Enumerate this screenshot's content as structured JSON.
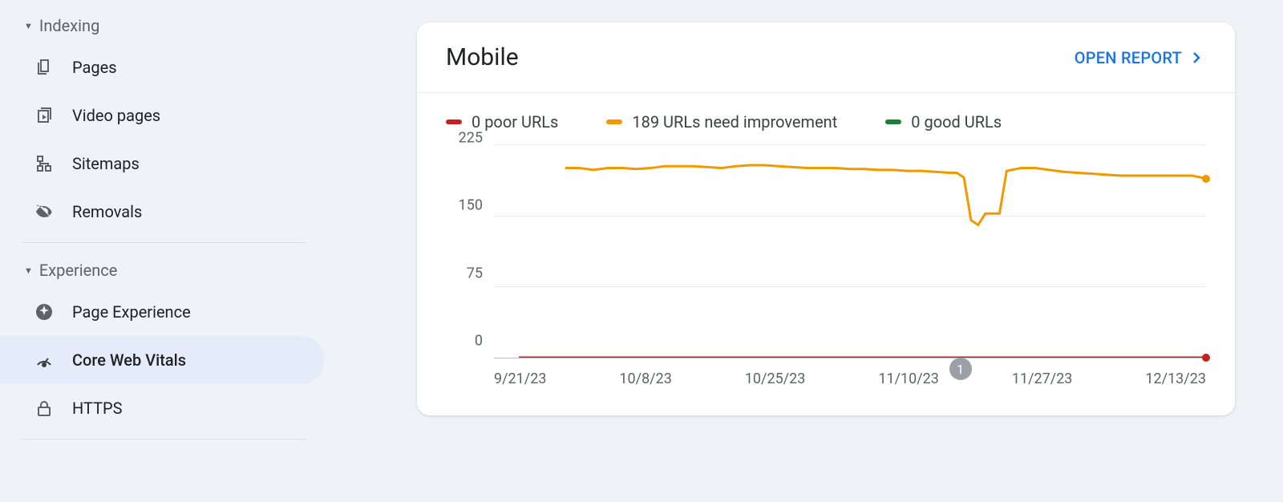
{
  "sidebar": {
    "sections": {
      "indexing": {
        "label": "Indexing",
        "items": [
          {
            "id": "pages",
            "label": "Pages"
          },
          {
            "id": "video-pages",
            "label": "Video pages"
          },
          {
            "id": "sitemaps",
            "label": "Sitemaps"
          },
          {
            "id": "removals",
            "label": "Removals"
          }
        ]
      },
      "experience": {
        "label": "Experience",
        "items": [
          {
            "id": "page-experience",
            "label": "Page Experience"
          },
          {
            "id": "core-web-vitals",
            "label": "Core Web Vitals"
          },
          {
            "id": "https",
            "label": "HTTPS"
          }
        ]
      }
    }
  },
  "card": {
    "title": "Mobile",
    "open_report": "OPEN REPORT"
  },
  "legend": {
    "poor_label": "0 poor URLs",
    "need_label": "189 URLs need improvement",
    "good_label": "0 good URLs"
  },
  "colors": {
    "poor": "#c5221f",
    "need": "#f29900",
    "good": "#188038"
  },
  "marker": {
    "label": "1"
  },
  "chart_data": {
    "type": "line",
    "xlabel": "",
    "ylabel": "",
    "ylim": [
      0,
      225
    ],
    "y_ticks": [
      "225",
      "150",
      "75",
      "0"
    ],
    "x_ticks": [
      "9/21/23",
      "10/8/23",
      "10/25/23",
      "11/10/23",
      "11/27/23",
      "12/13/23"
    ],
    "series": [
      {
        "name": "poor",
        "color": "#c5221f",
        "x": [
          3.5,
          100
        ],
        "values": [
          0,
          0
        ]
      },
      {
        "name": "need_improvement",
        "color": "#f29900",
        "x": [
          10,
          12,
          14,
          16,
          18,
          20,
          22,
          24,
          26,
          28,
          30,
          32,
          34,
          36,
          38,
          40,
          42,
          44,
          46,
          48,
          50,
          52,
          54,
          56,
          58,
          60,
          62,
          64,
          65,
          66,
          67,
          68,
          69,
          70,
          71,
          72,
          74,
          76,
          78,
          80,
          82,
          84,
          86,
          88,
          90,
          92,
          94,
          96,
          98,
          100
        ],
        "values": [
          200,
          200,
          198,
          200,
          200,
          199,
          200,
          202,
          202,
          202,
          201,
          200,
          202,
          203,
          203,
          202,
          201,
          200,
          200,
          200,
          199,
          199,
          198,
          198,
          197,
          197,
          196,
          195,
          195,
          190,
          145,
          140,
          152,
          152,
          152,
          197,
          200,
          200,
          198,
          196,
          195,
          194,
          193,
          192,
          192,
          192,
          192,
          192,
          192,
          189
        ]
      },
      {
        "name": "good",
        "color": "#188038",
        "x": [],
        "values": []
      }
    ],
    "event_markers": [
      {
        "label": "1",
        "x": 65.5
      }
    ]
  }
}
